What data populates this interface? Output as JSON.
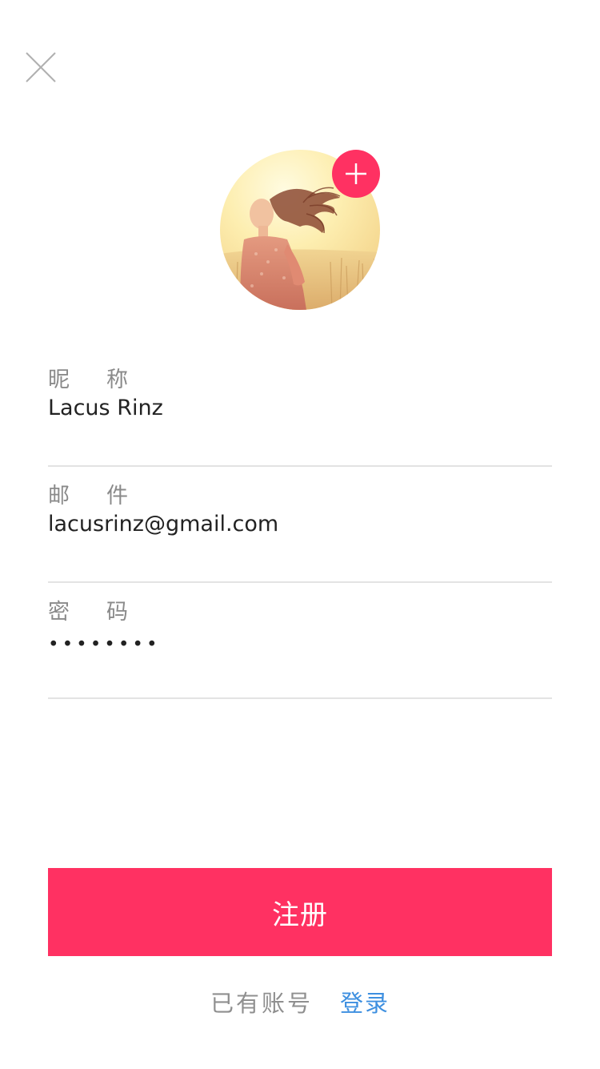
{
  "header": {
    "close_icon": "close-icon"
  },
  "avatar": {
    "add_icon": "plus-icon",
    "accent_color": "#ff3162"
  },
  "form": {
    "nickname": {
      "label_first": "昵",
      "label_second": "称",
      "value": "Lacus Rinz"
    },
    "email": {
      "label_first": "邮",
      "label_second": "件",
      "value": "lacusrinz@gmail.com"
    },
    "password": {
      "label_first": "密",
      "label_second": "码",
      "masked_value": "••••••••"
    }
  },
  "actions": {
    "register_label": "注册",
    "register_color": "#ff3162"
  },
  "footer": {
    "have_account": "已有账号",
    "login_label": "登录",
    "login_color": "#3d8fe0"
  }
}
